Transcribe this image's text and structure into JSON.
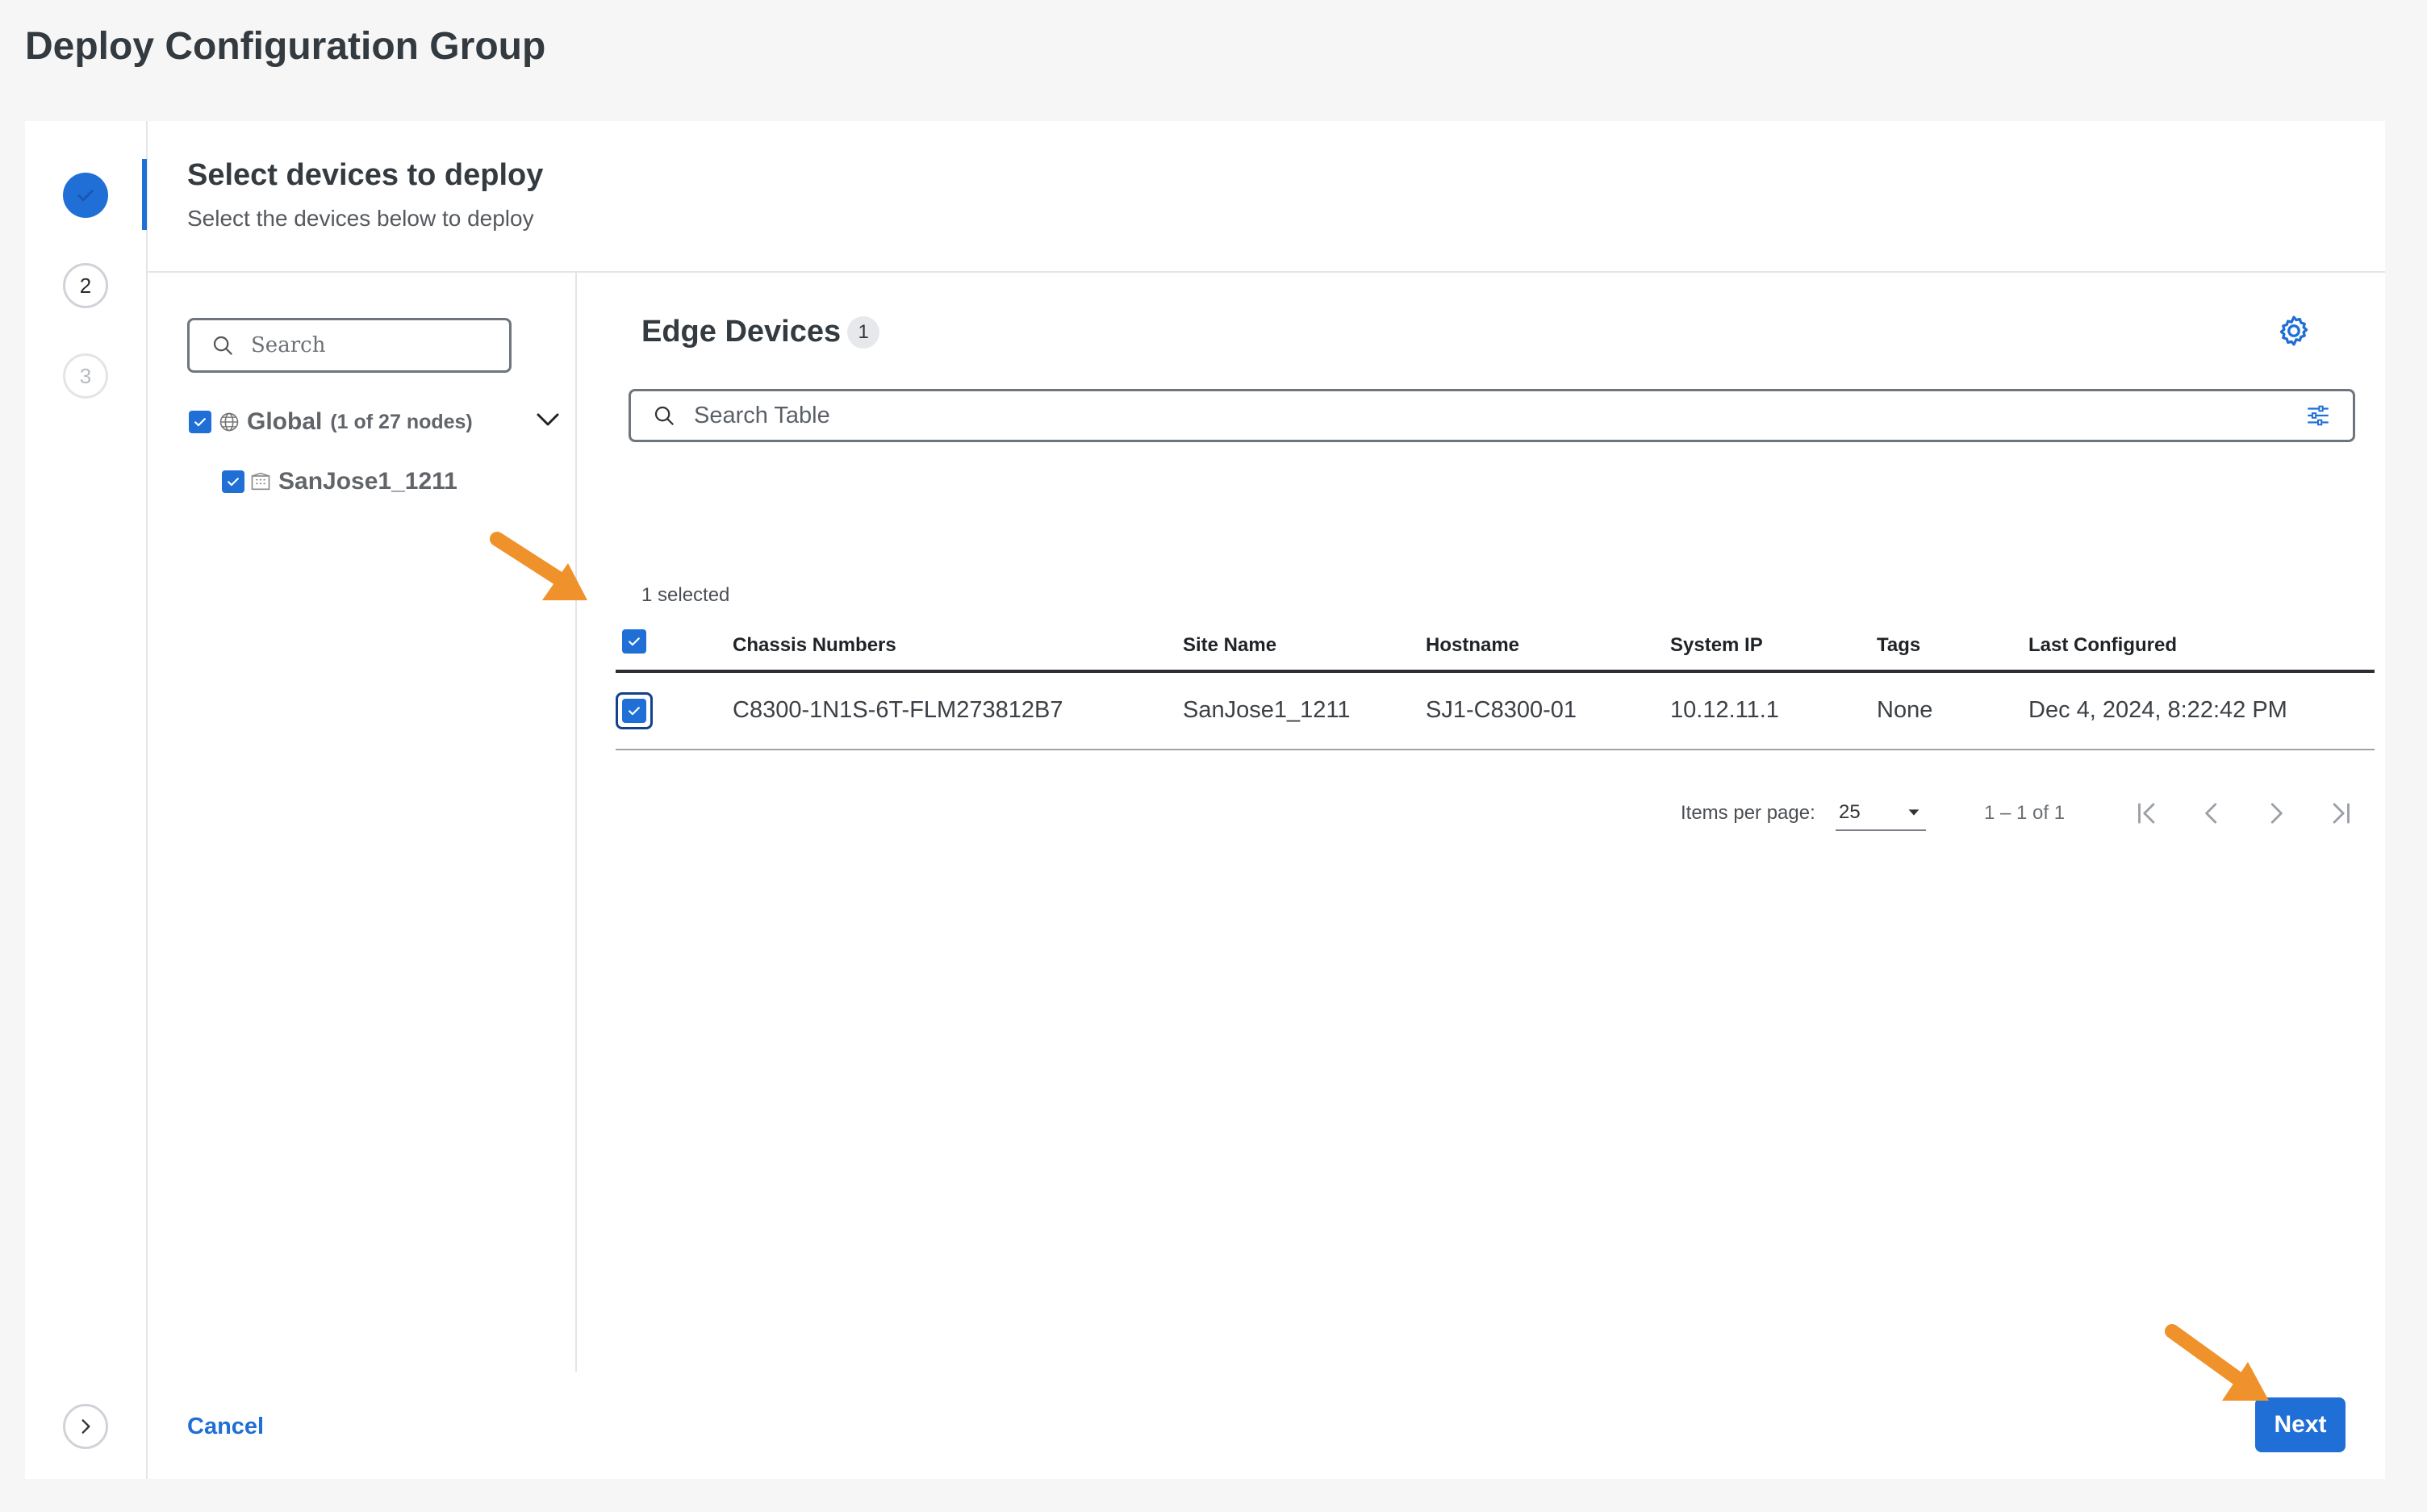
{
  "page": {
    "title": "Deploy Configuration Group"
  },
  "stepper": {
    "steps": [
      {
        "label": "1",
        "status": "completed",
        "icon": "check-icon"
      },
      {
        "label": "2",
        "status": "current"
      },
      {
        "label": "3",
        "status": "upcoming"
      }
    ]
  },
  "step_header": {
    "title": "Select devices to deploy",
    "subtitle": "Select the devices below to deploy"
  },
  "tree": {
    "search_placeholder": "Search",
    "global_label": "Global",
    "global_count": "(1 of 27 nodes)",
    "site_label": "SanJose1_1211"
  },
  "table": {
    "title": "Edge Devices",
    "count": "1",
    "search_placeholder": "Search Table",
    "selected_text": "1 selected",
    "columns": [
      "Chassis Numbers",
      "Site Name",
      "Hostname",
      "System IP",
      "Tags",
      "Last Configured"
    ],
    "rows": [
      {
        "selected": true,
        "cells": [
          "C8300-1N1S-6T-FLM273812B7",
          "SanJose1_1211",
          "SJ1-C8300-01",
          "10.12.11.1",
          "None",
          "Dec 4, 2024, 8:22:42 PM"
        ]
      }
    ],
    "pagination": {
      "items_per_page_label": "Items per page:",
      "items_per_page": "25",
      "range": "1 – 1 of 1"
    }
  },
  "footer": {
    "cancel_label": "Cancel",
    "next_label": "Next"
  },
  "colors": {
    "accent": "#1f6fd6",
    "annotation_arrow": "#f0922b",
    "background": "#f6f6f6"
  }
}
